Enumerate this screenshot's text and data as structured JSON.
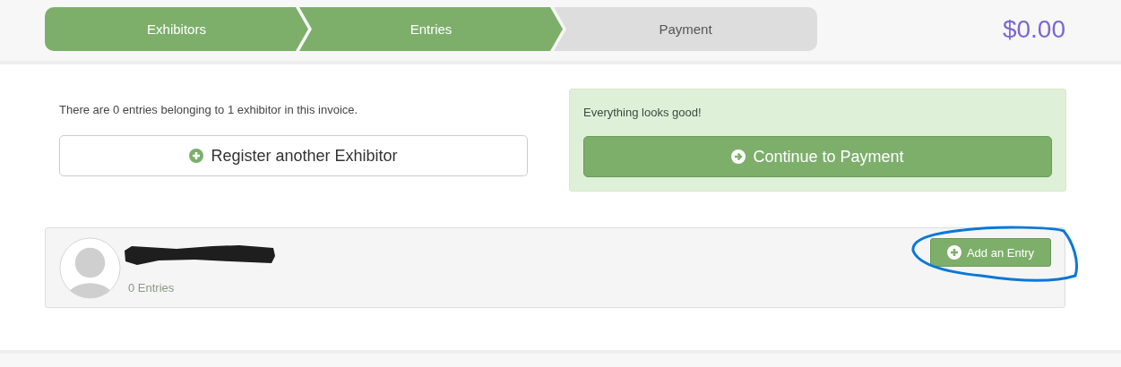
{
  "steps": [
    {
      "label": "Exhibitors",
      "done": true
    },
    {
      "label": "Entries",
      "done": true
    },
    {
      "label": "Payment",
      "done": false
    }
  ],
  "total": "$0.00",
  "summary": "There are 0 entries belonging to 1 exhibitor in this invoice.",
  "register_button": "Register another Exhibitor",
  "status": {
    "message": "Everything looks good!",
    "button": "Continue to Payment"
  },
  "exhibitors": [
    {
      "name_redacted": true,
      "entries": "0 Entries",
      "add_button": "Add an Entry",
      "annotated": true
    }
  ]
}
